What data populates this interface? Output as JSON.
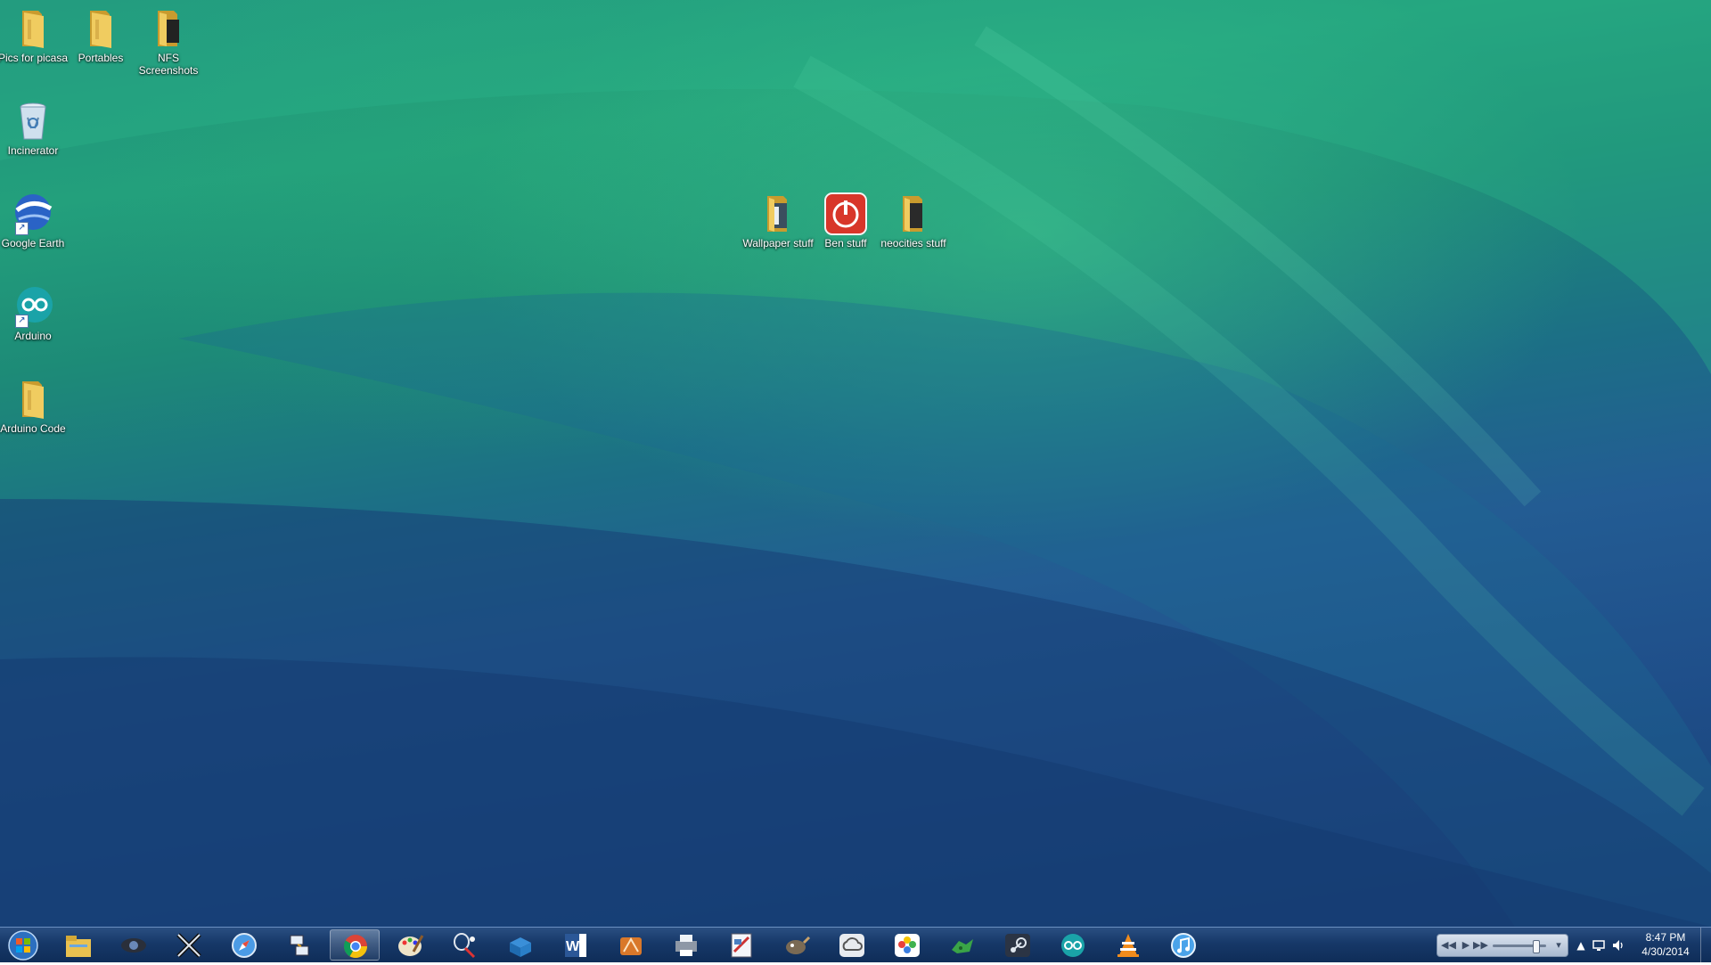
{
  "desktop": {
    "icons": [
      {
        "label": "Pics for picasa",
        "icon": "folder-icon"
      },
      {
        "label": "Portables",
        "icon": "folder-icon"
      },
      {
        "label": "NFS Screenshots",
        "icon": "folder-icon"
      },
      {
        "label": "Incinerator",
        "icon": "recycle-bin-icon"
      },
      {
        "label": "Google Earth",
        "icon": "google-earth-icon"
      },
      {
        "label": "Arduino",
        "icon": "arduino-icon"
      },
      {
        "label": "Arduino Code",
        "icon": "folder-icon"
      },
      {
        "label": "Wallpaper stuff",
        "icon": "folder-icon"
      },
      {
        "label": "Ben stuff",
        "icon": "power-icon"
      },
      {
        "label": "neocities stuff",
        "icon": "folder-icon"
      }
    ]
  },
  "taskbar": {
    "pinned": [
      "start-orb-icon",
      "file-explorer-icon",
      "webcam-icon",
      "xbmc-icon",
      "safari-icon",
      "network-tool-icon",
      "chrome-icon",
      "paint-icon",
      "badminton-icon",
      "lego-brick-icon",
      "word-icon",
      "app-orange-icon",
      "printer-icon",
      "photo-editor-icon",
      "gimp-icon",
      "cloud-icon",
      "photos-icon",
      "game-icon",
      "steam-icon",
      "arduino-icon",
      "vlc-icon",
      "itunes-icon"
    ],
    "active_app": "chrome-icon",
    "volume_level": 0.8
  },
  "clock": {
    "time": "8:47 PM",
    "date": "4/30/2014"
  },
  "colors": {
    "folder": "#e8c35a",
    "ben_stuff": "#d8362a",
    "arduino": "#1aa3a8",
    "taskbar": "#163868"
  }
}
